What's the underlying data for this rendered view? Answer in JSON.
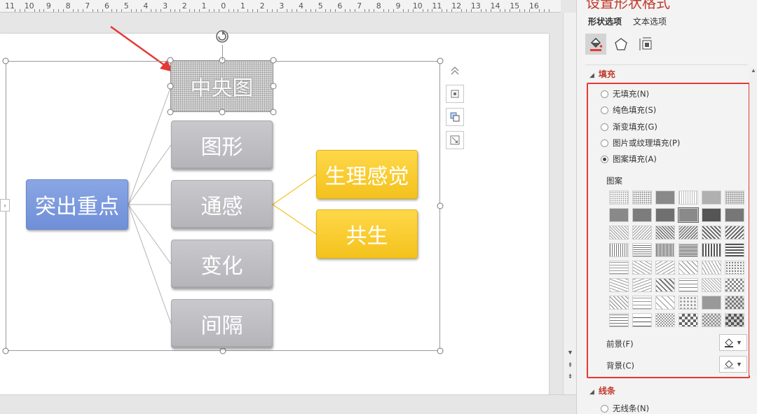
{
  "ruler": {
    "labels": [
      "11",
      "10",
      "9",
      "8",
      "7",
      "6",
      "5",
      "4",
      "3",
      "2",
      "1",
      "0",
      "1",
      "2",
      "3",
      "4",
      "5",
      "6",
      "7",
      "8",
      "9",
      "10",
      "11",
      "12",
      "13",
      "14",
      "15",
      "16"
    ]
  },
  "smartart": {
    "root": "突出重点",
    "children": [
      "中央图",
      "图形",
      "通感",
      "变化",
      "间隔"
    ],
    "grandchildren": [
      "生理感觉",
      "共生"
    ]
  },
  "pane": {
    "title": "设置形状格式",
    "tabs": [
      "形状选项",
      "文本选项"
    ],
    "icons": [
      "fill-line-icon",
      "effects-icon",
      "size-properties-icon"
    ],
    "fill_section": "填充",
    "fill_options": [
      "无填充(N)",
      "纯色填充(S)",
      "渐变填充(G)",
      "图片或纹理填充(P)",
      "图案填充(A)"
    ],
    "selected_fill": "图案填充(A)",
    "pattern_label": "图案",
    "foreground_label": "前景(F)",
    "background_label": "背景(C)",
    "line_section": "线条",
    "line_first_option": "无线条(N)"
  },
  "colors": {
    "accent_red": "#e53935",
    "node_gray": "#bcbcc1",
    "node_blue": "#7896dc",
    "node_yellow": "#f6c823"
  }
}
